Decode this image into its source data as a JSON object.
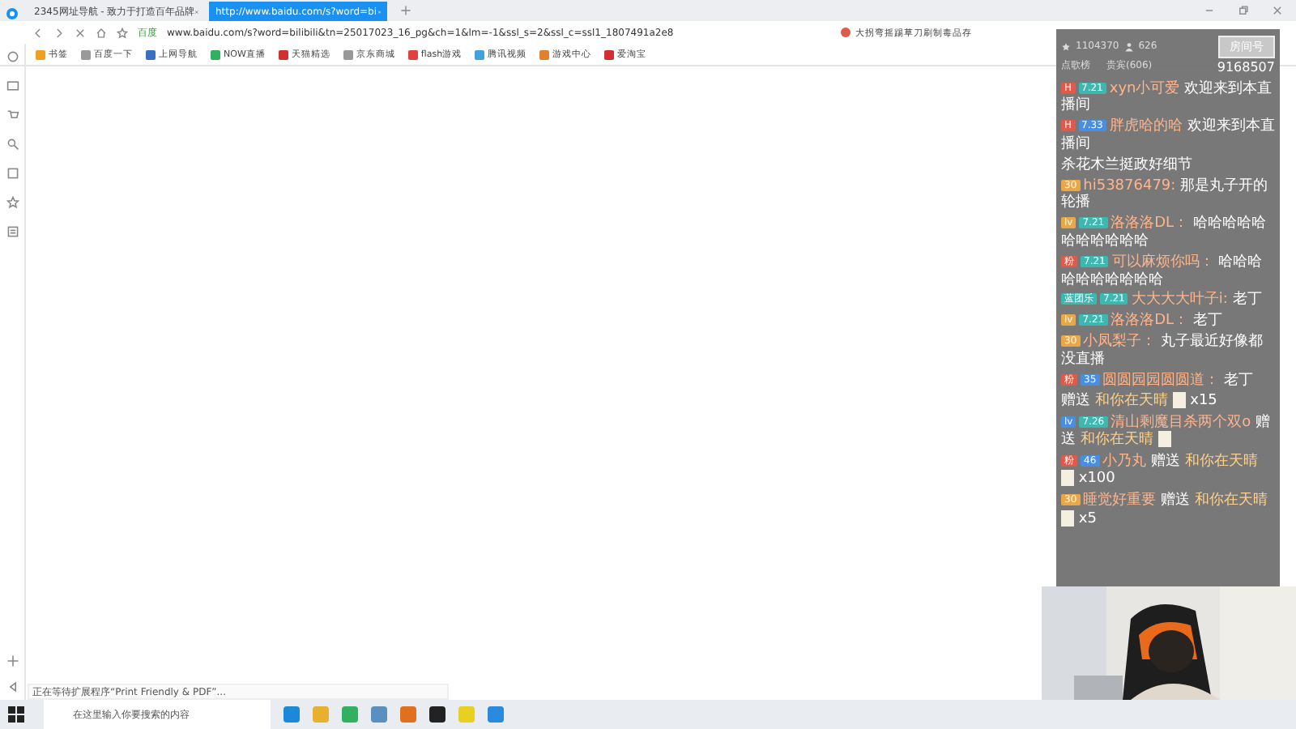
{
  "tabs": [
    {
      "label": "2345网址导航 - 致力于打造百年品牌",
      "selected": false
    },
    {
      "label": "http://www.baidu.com/s?word=bi",
      "selected": true
    }
  ],
  "address": {
    "site_label": "百度",
    "url": "www.baidu.com/s?word=bilibili&tn=25017023_16_pg&ch=1&lm=-1&ssl_s=2&ssl_c=ssl1_1807491a2e8"
  },
  "search_suggestion": "大拐弯摇踢草刀刷制毒品存",
  "bookmarks": [
    "书签",
    "百度一下",
    "上网导航",
    "NOW直播",
    "天猫精选",
    "京东商城",
    "flash游戏",
    "腾讯视频",
    "游戏中心",
    "爱淘宝"
  ],
  "status_text": "正在等待扩展程序“Print Friendly & PDF”...",
  "chat": {
    "popularity": "1104370",
    "viewers": "626",
    "room_button": "房间号",
    "tab_rank": "点歌榜",
    "tab_guests": "贵宾(606)",
    "room_number": "9168507",
    "messages": [
      {
        "badges": [
          {
            "label": "H",
            "color": "#e05a4a"
          },
          {
            "label": "7.21",
            "color": "#3cb8b0"
          }
        ],
        "user": "xyn小可爱",
        "text": "欢迎来到本直播间"
      },
      {
        "badges": [
          {
            "label": "H",
            "color": "#e05a4a"
          },
          {
            "label": "7.33",
            "color": "#4a8ee0"
          }
        ],
        "user": "胖虎哈的哈",
        "text": "欢迎来到本直播间"
      },
      {
        "text": "杀花木兰挺政好细节"
      },
      {
        "badges": [
          {
            "label": "30",
            "color": "#e8a84a"
          }
        ],
        "user": "hi53876479:",
        "text": "那是丸子开的轮播"
      },
      {
        "badges": [
          {
            "label": "lv",
            "color": "#e8a84a"
          },
          {
            "label": "7.21",
            "color": "#3cb8b0"
          }
        ],
        "user": "洛洛洛DL：",
        "text": "哈哈哈哈哈哈哈哈哈哈哈"
      },
      {
        "badges": [
          {
            "label": "粉",
            "color": "#e05a4a"
          },
          {
            "label": "7.21",
            "color": "#3cb8b0"
          }
        ],
        "user": "可以麻烦你吗：",
        "text": "哈哈哈哈哈哈哈哈哈哈"
      },
      {
        "badges": [
          {
            "label": "蓝团乐",
            "color": "#3cb8b0"
          },
          {
            "label": "7.21",
            "color": "#3cb8b0"
          }
        ],
        "user": "大大大大叶子i:",
        "text": "老丁"
      },
      {
        "badges": [
          {
            "label": "lv",
            "color": "#e8a84a"
          },
          {
            "label": "7.21",
            "color": "#3cb8b0"
          }
        ],
        "user": "洛洛洛DL：",
        "text": "老丁"
      },
      {
        "badges": [
          {
            "label": "30",
            "color": "#e8a84a"
          }
        ],
        "user": "小凤梨子：",
        "text": "丸子最近好像都没直播"
      },
      {
        "badges": [
          {
            "label": "粉",
            "color": "#e05a4a"
          },
          {
            "label": "35",
            "color": "#4a8ee0"
          }
        ],
        "user": "圆圆园园圆圆道：",
        "text": "老丁"
      },
      {
        "text": "赠送",
        "gift": "和你在天晴",
        "count": "x15"
      },
      {
        "badges": [
          {
            "label": "lv",
            "color": "#4a8ee0"
          },
          {
            "label": "7.26",
            "color": "#3cb8b0"
          }
        ],
        "user": "清山剩魔目杀两个双o",
        "text": "赠送",
        "gift": "和你在天晴"
      },
      {
        "badges": [
          {
            "label": "粉",
            "color": "#e05a4a"
          },
          {
            "label": "46",
            "color": "#4a8ee0"
          }
        ],
        "user": "小乃丸",
        "text": "赠送",
        "gift": "和你在天晴",
        "count": "x100"
      },
      {
        "badges": [
          {
            "label": "30",
            "color": "#e8a84a"
          }
        ],
        "user": "睡觉好重要",
        "text": "赠送",
        "gift": "和你在天晴",
        "count": "x5"
      }
    ]
  },
  "taskbar": {
    "search_placeholder": "在这里输入你要搜索的内容",
    "apps": [
      {
        "color": "#1e88d8"
      },
      {
        "color": "#e8b030"
      },
      {
        "color": "#30b060"
      },
      {
        "color": "#5a90c0"
      },
      {
        "color": "#e07020"
      },
      {
        "color": "#222222"
      },
      {
        "color": "#e8d020"
      },
      {
        "color": "#2a8ae0"
      }
    ]
  }
}
